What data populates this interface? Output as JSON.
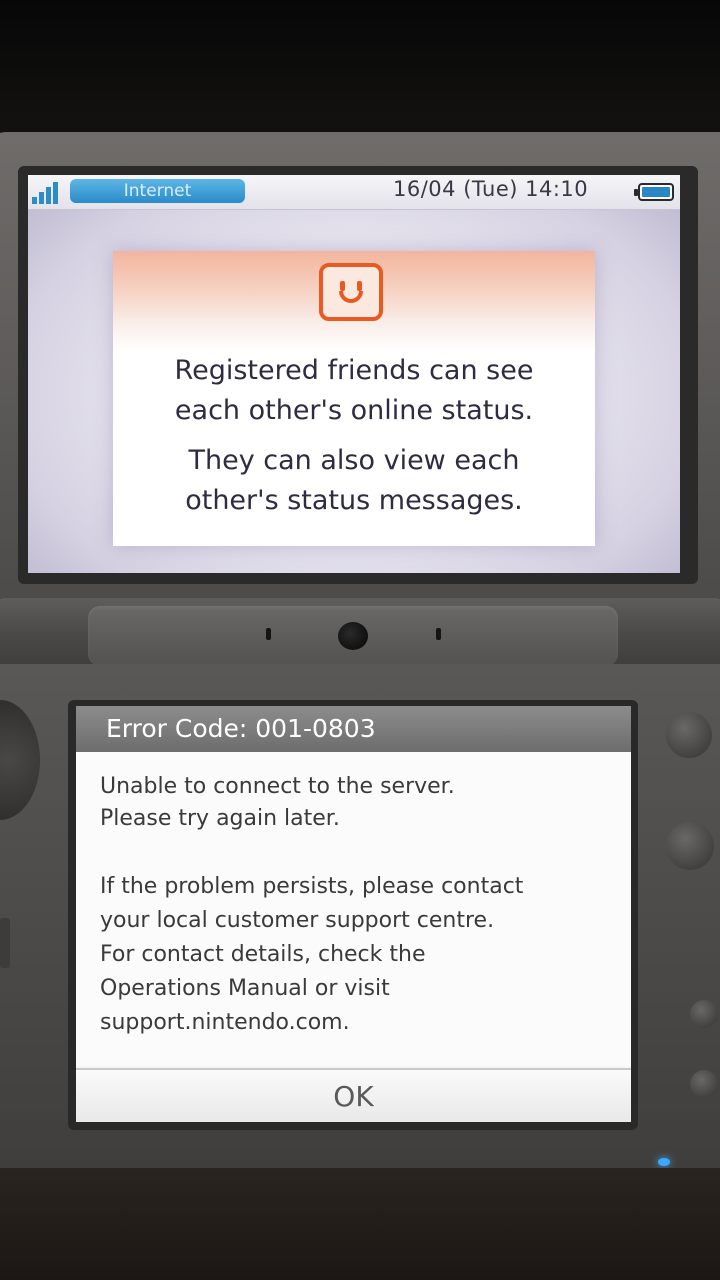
{
  "top_screen": {
    "status_bar": {
      "signal_icon": "wifi-signal-icon",
      "connection_label": "Internet",
      "datetime": "16/04 (Tue) 14:10",
      "battery_icon": "battery-icon"
    },
    "info_card": {
      "icon": "smiley-face-icon",
      "line1": "Registered friends can see",
      "line2": "each other's online status.",
      "line3": "They can also view each",
      "line4": "other's status messages."
    }
  },
  "bottom_screen": {
    "error_title": "Error Code: 001-0803",
    "message_lines": [
      "Unable to connect to the server.",
      "Please try again later.",
      "If the problem persists, please contact",
      "your local customer support centre.",
      "For contact details, check the",
      "Operations Manual or visit",
      "support.nintendo.com."
    ],
    "ok_label": "OK"
  },
  "colors": {
    "accent_blue": "#2a8ac9",
    "icon_orange": "#e85a22",
    "header_gray": "#7a7a7a",
    "led_blue": "#3aa8ff"
  }
}
